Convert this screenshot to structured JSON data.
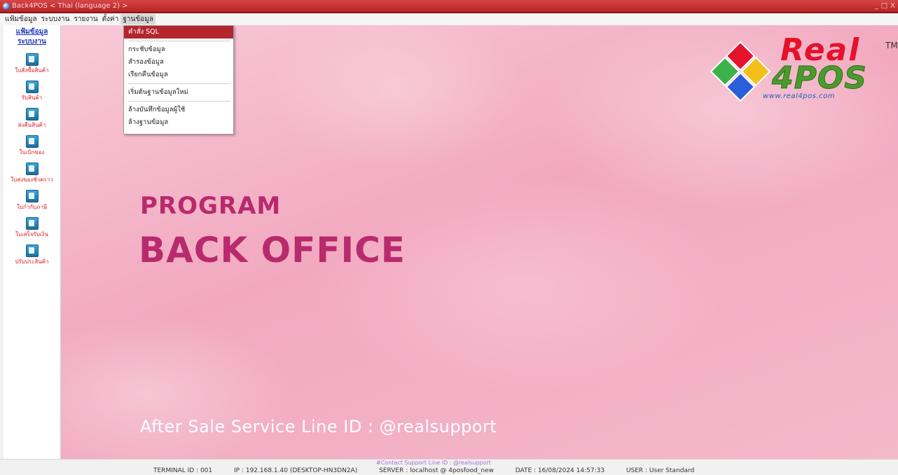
{
  "window": {
    "title": "Back4POS  < Thai (language 2) >",
    "controls": [
      "_",
      "□",
      "X"
    ]
  },
  "menubar": [
    "แฟ้มข้อมูล",
    "ระบบงาน",
    "รายงาน",
    "ตั้งค่า",
    "ฐานข้อมูล"
  ],
  "sidebar": {
    "header": [
      "แฟ้มข้อมูล",
      "ระบบงาน"
    ],
    "items": [
      {
        "label": "ใบสั่งซื้อสินค้า",
        "icon": "doc-icon"
      },
      {
        "label": "รับสินค้า",
        "icon": "receive-icon"
      },
      {
        "label": "ส่งคืนสินค้า",
        "icon": "return-icon"
      },
      {
        "label": "ใบเบิกของ",
        "icon": "requisition-icon"
      },
      {
        "label": "ใบส่งของชั่วคราว",
        "icon": "delivery-icon"
      },
      {
        "label": "ใบกำกับภาษี",
        "icon": "tax-invoice-icon"
      },
      {
        "label": "ใบเสร็จรับเงิน",
        "icon": "receipt-icon"
      },
      {
        "label": "ปรับประสินค้า",
        "icon": "adjust-icon"
      }
    ]
  },
  "dropdown": {
    "items": [
      {
        "label": "คำสั่ง SQL",
        "selected": true
      },
      {
        "sep": true
      },
      {
        "label": "กระชับข้อมูล"
      },
      {
        "label": "สำรองข้อมูล"
      },
      {
        "label": "เรียกคืนข้อมูล"
      },
      {
        "sep": true
      },
      {
        "label": "เริ่มต้นฐานข้อมูลใหม่"
      },
      {
        "sep": true
      },
      {
        "label": "ล้างบันทึกข้อมูลผู้ใช้"
      },
      {
        "label": "ล้างฐานข้อมูล"
      }
    ]
  },
  "main": {
    "line1": "PROGRAM",
    "line2": "BACK OFFICE",
    "support": "After Sale Service Line ID : @realsupport"
  },
  "logo": {
    "real": "Real",
    "tm": "TM",
    "fourpos": "4POS",
    "url": "www.real4pos.com"
  },
  "status": {
    "contact": "#Contact Support Line ID : @realsupport",
    "terminal": "TERMINAL ID : 001",
    "ip": "IP : 192.168.1.40 (DESKTOP-HN3DN2A)",
    "server": "SERVER : localhost @ 4posfood_new",
    "date": "DATE : 16/08/2024  14:57:33",
    "user": "USER : User Standard"
  },
  "colors": {
    "accent": "#b82a6d",
    "titlebar": "#c83030",
    "selected": "#b3262e"
  }
}
